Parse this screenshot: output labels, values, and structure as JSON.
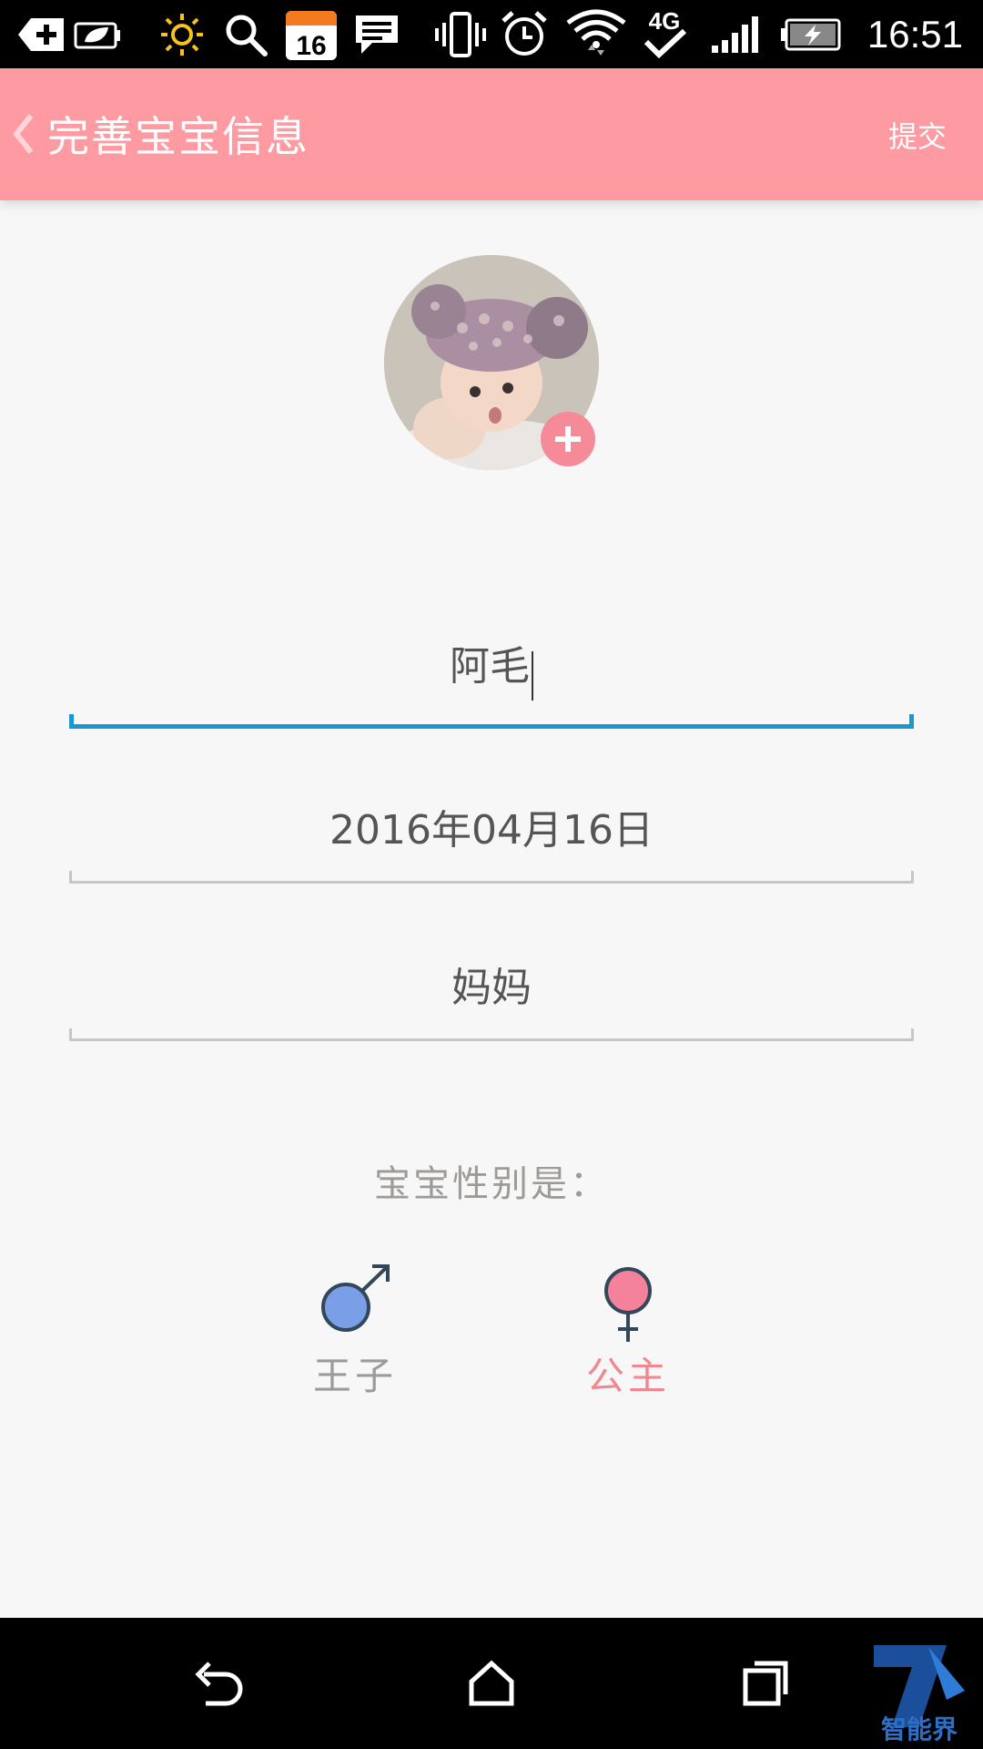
{
  "status_bar": {
    "time": "16:51",
    "calendar_day": "16",
    "network": "4G",
    "icons": [
      "add-notification-icon",
      "leaf-battery-icon",
      "brightness-icon",
      "search-icon",
      "calendar-icon",
      "message-icon",
      "vibrate-icon",
      "alarm-icon",
      "wifi-icon",
      "network-4g-icon",
      "signal-icon",
      "battery-charging-icon"
    ]
  },
  "app_bar": {
    "title": "完善宝宝信息",
    "submit_label": "提交",
    "background": "#fd9aa2"
  },
  "form": {
    "name_value": "阿毛",
    "birthday_value": "2016年04月16日",
    "relation_value": "妈妈"
  },
  "gender": {
    "question": "宝宝性别是：",
    "boy_label": "王子",
    "girl_label": "公主",
    "selected": "girl",
    "boy_color": "#7b9fe6",
    "girl_color": "#f4829a"
  },
  "nav_bar": {
    "icons": [
      "back-icon",
      "home-icon",
      "recent-apps-icon"
    ]
  },
  "watermark": {
    "text": "智能界"
  },
  "colors": {
    "accent_blue": "#1898cc",
    "pink": "#fd9aa2"
  }
}
